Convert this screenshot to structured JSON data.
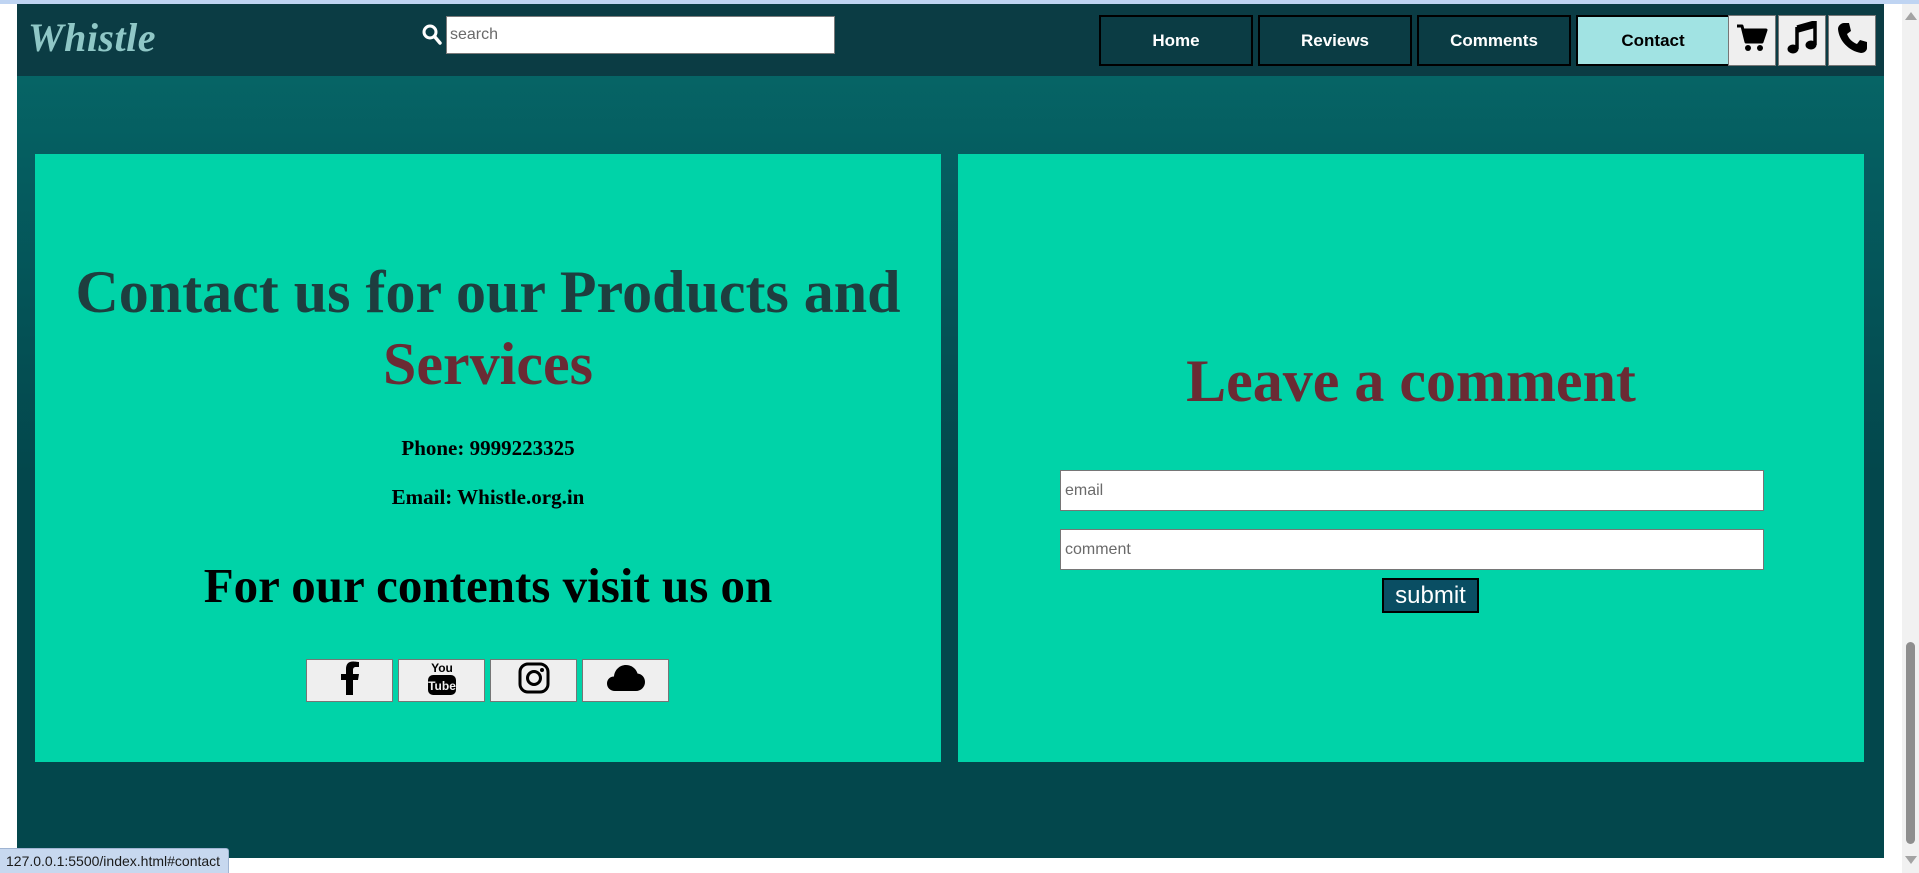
{
  "navbar": {
    "logo": "Whistle",
    "search": {
      "placeholder": "search",
      "value": ""
    },
    "nav_items": [
      {
        "label": "Home",
        "active": false
      },
      {
        "label": "Reviews",
        "active": false
      },
      {
        "label": "Comments",
        "active": false
      },
      {
        "label": "Contact",
        "active": true
      }
    ],
    "icon_buttons": [
      "shopping-cart-icon",
      "music-note-icon",
      "phone-icon"
    ]
  },
  "contact": {
    "title_main": "Contact us for our Products and",
    "title_accent": "Services",
    "phone": "Phone: 9999223325",
    "email": "Email: Whistle.org.in",
    "visit_heading": "For our contents visit us on",
    "social_links": [
      "facebook-icon",
      "youtube-icon",
      "instagram-icon",
      "soundcloud-icon"
    ]
  },
  "comment_form": {
    "title": "Leave a comment",
    "email_placeholder": "email",
    "comment_placeholder": "comment",
    "submit_label": "submit"
  },
  "status_bar": {
    "url": "127.0.0.1:5500/index.html#contact"
  },
  "colors": {
    "navbar_bg": "#0b3c44",
    "panel_bg": "#00d3a8",
    "active_nav_bg": "#a1e3e3",
    "title_dark": "#1e3e3f",
    "title_accent": "#6a2b34",
    "logo": "#8fc7c6",
    "submit_bg": "#0a4e63"
  }
}
